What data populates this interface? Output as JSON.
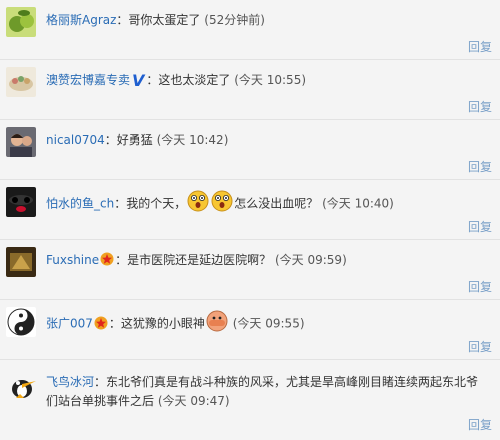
{
  "comments": [
    {
      "name": "格丽斯Agraz",
      "text": "：哥你太蛋定了",
      "time": "(52分钟前)",
      "reply": "回复"
    },
    {
      "name": "澳赞宏博嘉专卖",
      "text": "：这也太淡定了",
      "time": "(今天 10:55)",
      "reply": "回复",
      "badge": "V"
    },
    {
      "name": "nical0704",
      "text": "：好勇猛",
      "time": "(今天 10:42)",
      "reply": "回复"
    },
    {
      "name": "怕水的鱼_ch",
      "text": "：我的个天，",
      "text2": "怎么没出血呢？",
      "time": "(今天 10:40)",
      "reply": "回复",
      "icons": [
        "shocked-face-icon",
        "shocked-face-icon"
      ]
    },
    {
      "name": "Fuxshine",
      "text": "：是市医院还是延边医院啊？",
      "time": "(今天 09:59)",
      "reply": "回复",
      "badge_icon": "star-medal-icon"
    },
    {
      "name": "张广007",
      "text": "：这犹豫的小眼神",
      "time": "(今天 09:55)",
      "reply": "回复",
      "badge_icon": "star-medal-icon",
      "icons": [
        "peeking-face-icon"
      ]
    },
    {
      "name": "飞鸟冰河",
      "text": "：东北爷们真是有战斗种族的风采，尤其是旱高峰刚目睹连续两起东北爷们站台单挑事件之后",
      "time": "(今天 09:47)",
      "reply": "回复"
    }
  ]
}
